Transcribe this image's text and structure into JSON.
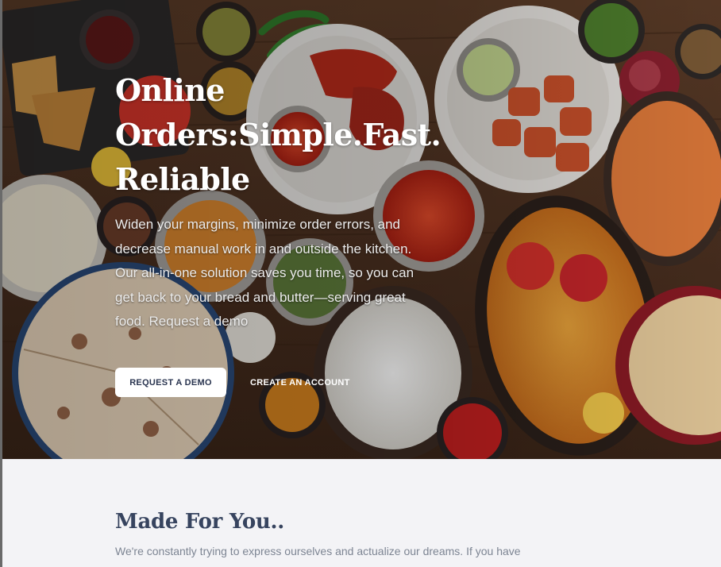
{
  "hero": {
    "title_lines": [
      "Online",
      "Orders:Simple.Fast.",
      "Reliable"
    ],
    "description": "Widen your margins, minimize order errors, and decrease manual work in and outside the kitchen. Our all-in-one solution saves you time, so you can get back to your bread and butter—serving great food. Request a demo",
    "primary_button": "REQUEST A DEMO",
    "secondary_button": "CREATE AN ACCOUNT"
  },
  "made_for_you": {
    "title": "Made For You..",
    "text": "We're constantly trying to express ourselves and actualize our dreams. If you have"
  },
  "colors": {
    "section_background": "#f3f3f6",
    "heading": "#37445f",
    "body_text": "#7d8593",
    "button_background": "#ffffff",
    "button_text": "#2a3550"
  }
}
